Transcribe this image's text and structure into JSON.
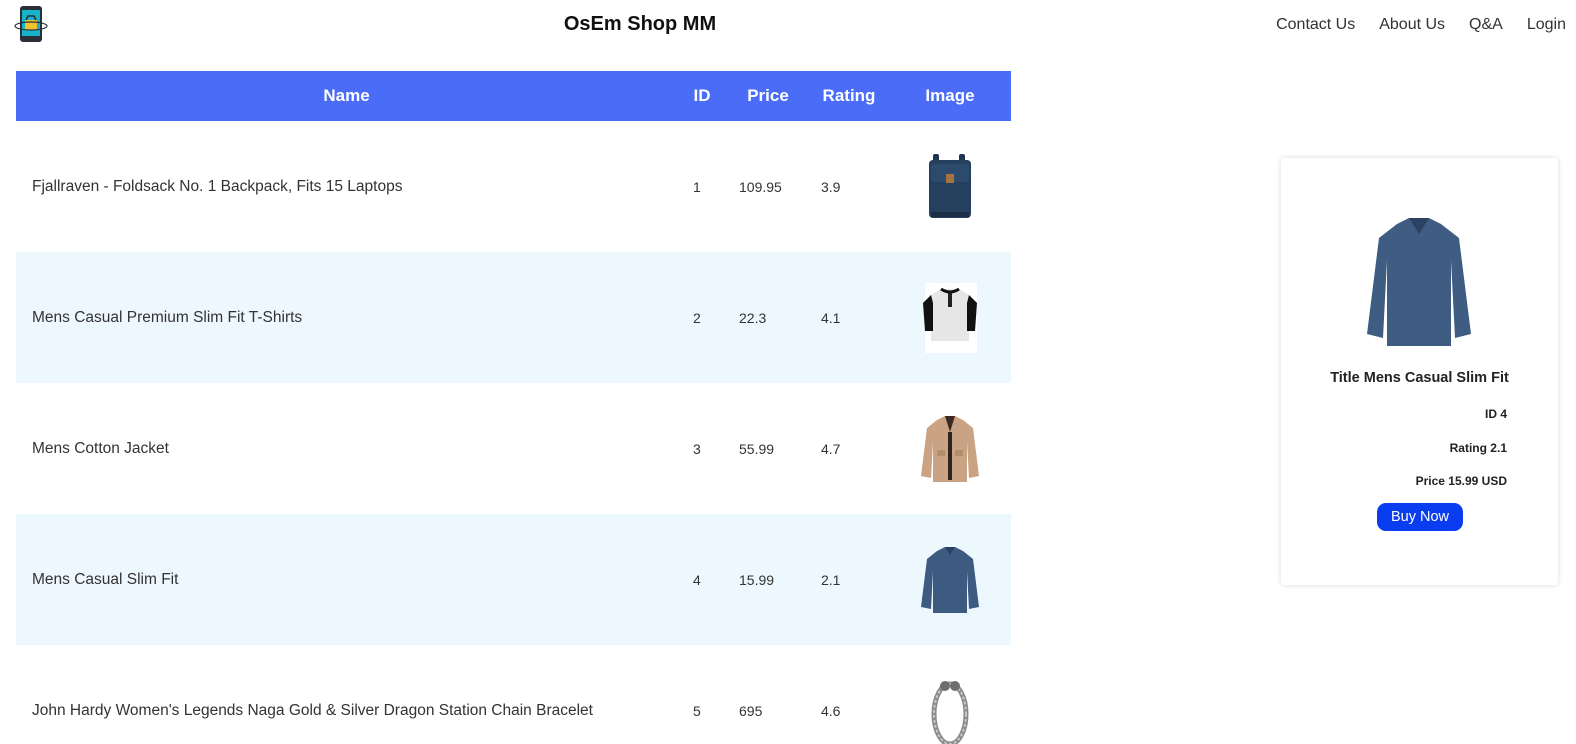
{
  "header": {
    "title": "OsEm Shop MM",
    "nav": [
      "Contact Us",
      "About Us",
      "Q&A",
      "Login"
    ],
    "logo_icon": "shop-phone-logo-icon"
  },
  "table": {
    "columns": [
      "Name",
      "ID",
      "Price",
      "Rating",
      "Image"
    ],
    "rows": [
      {
        "name": "Fjallraven - Foldsack No. 1 Backpack, Fits 15 Laptops",
        "id": "1",
        "price": "109.95",
        "rating": "3.9",
        "image": "backpack-image"
      },
      {
        "name": "Mens Casual Premium Slim Fit T-Shirts",
        "id": "2",
        "price": "22.3",
        "rating": "4.1",
        "image": "tshirt-image"
      },
      {
        "name": "Mens Cotton Jacket",
        "id": "3",
        "price": "55.99",
        "rating": "4.7",
        "image": "jacket-image"
      },
      {
        "name": "Mens Casual Slim Fit",
        "id": "4",
        "price": "15.99",
        "rating": "2.1",
        "image": "longsleeve-image"
      },
      {
        "name": "John Hardy Women's Legends Naga Gold & Silver Dragon Station Chain Bracelet",
        "id": "5",
        "price": "695",
        "rating": "4.6",
        "image": "bracelet-image"
      }
    ],
    "header_color": "#4a6cf7",
    "stripe_color": "#edf7fe"
  },
  "card": {
    "title": "Title Mens Casual Slim Fit",
    "id_line": "ID 4",
    "rating_line": "Rating 2.1",
    "price_line": "Price 15.99 USD",
    "button_label": "Buy Now",
    "button_color": "#0a3cf0"
  }
}
